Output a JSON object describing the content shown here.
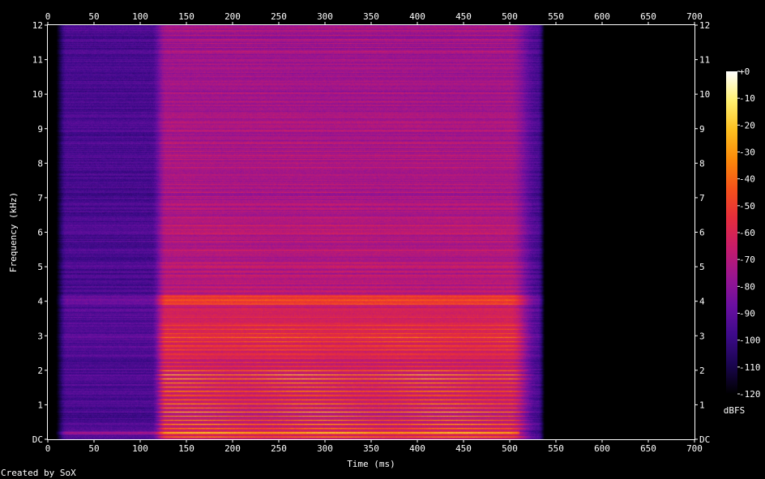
{
  "chart_data": {
    "type": "heatmap",
    "title": "",
    "xlabel": "Time (ms)",
    "ylabel": "Frequency (kHz)",
    "xlim": [
      0,
      700
    ],
    "ylim": [
      0,
      12
    ],
    "x_ticks": [
      0,
      50,
      100,
      150,
      200,
      250,
      300,
      350,
      400,
      450,
      500,
      550,
      600,
      650,
      700
    ],
    "y_ticks": [
      {
        "value": 0,
        "label": "DC"
      },
      {
        "value": 1,
        "label": "1"
      },
      {
        "value": 2,
        "label": "2"
      },
      {
        "value": 3,
        "label": "3"
      },
      {
        "value": 4,
        "label": "4"
      },
      {
        "value": 5,
        "label": "5"
      },
      {
        "value": 6,
        "label": "6"
      },
      {
        "value": 7,
        "label": "7"
      },
      {
        "value": 8,
        "label": "8"
      },
      {
        "value": 9,
        "label": "9"
      },
      {
        "value": 10,
        "label": "10"
      },
      {
        "value": 11,
        "label": "11"
      },
      {
        "value": 12,
        "label": "12"
      }
    ],
    "colorbar": {
      "label": "dBFS",
      "min": -120,
      "max": 0,
      "ticks": [
        "+0",
        "-10",
        "-20",
        "-30",
        "-40",
        "-50",
        "-60",
        "-70",
        "-80",
        "-90",
        "-100",
        "-110",
        "-120"
      ],
      "colors": [
        "#000000",
        "#1a0550",
        "#3d0a8a",
        "#6a0fa0",
        "#9a1590",
        "#c81c6a",
        "#e62d3c",
        "#f5521a",
        "#fb8a0a",
        "#fdc020",
        "#fff070",
        "#ffffff"
      ]
    },
    "signal": {
      "onset_ms": 10,
      "voiced_start_ms": 120,
      "end_ms": 530,
      "noise_level_db": -95,
      "voiced_noise_level_db": -65,
      "harmonic_spacing_khz": 0.12,
      "first_harmonic_khz": 0.2,
      "strong_harmonics_max_khz": 2.0,
      "formant_band_khz": [
        2.8,
        3.2
      ],
      "high_band_khz": [
        3.9,
        4.2
      ]
    }
  },
  "footer": {
    "credit": "Created by SoX"
  }
}
